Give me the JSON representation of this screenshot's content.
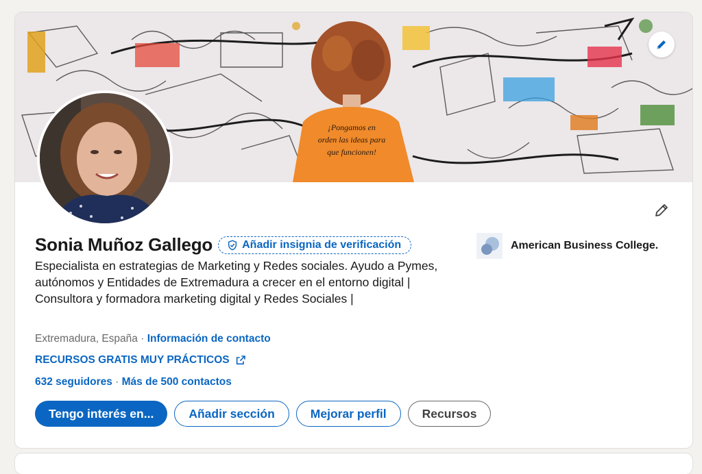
{
  "profile": {
    "name": "Sonia Muñoz Gallego",
    "verify_badge_label": "Añadir insignia de verificación",
    "headline": "Especialista en estrategias de Marketing y Redes sociales. Ayudo a Pymes, autónomos y Entidades de Extremadura a crecer en el entorno digital | Consultora y formadora marketing digital y Redes Sociales |",
    "location": "Extremadura, España",
    "location_separator": " · ",
    "contact_info_label": "Información de contacto",
    "resources_link": "RECURSOS GRATIS MUY PRÁCTICOS",
    "followers": "632 seguidores",
    "stats_separator": " · ",
    "connections": "Más de 500 contactos"
  },
  "banner": {
    "shirt_text_line1": "¡Pongamos en",
    "shirt_text_line2": "orden las ideas para",
    "shirt_text_line3": "que funcionen!"
  },
  "company": {
    "name": "American Business College."
  },
  "actions": {
    "open_to": "Tengo interés en...",
    "add_section": "Añadir sección",
    "enhance_profile": "Mejorar perfil",
    "resources": "Recursos"
  },
  "icons": {
    "banner_edit": "pencil-icon",
    "profile_edit": "pencil-icon",
    "verify": "shield-check-icon",
    "external": "external-link-icon"
  },
  "colors": {
    "primary": "#0a66c2",
    "page_bg": "#f3f2ef",
    "card_bg": "#ffffff"
  }
}
